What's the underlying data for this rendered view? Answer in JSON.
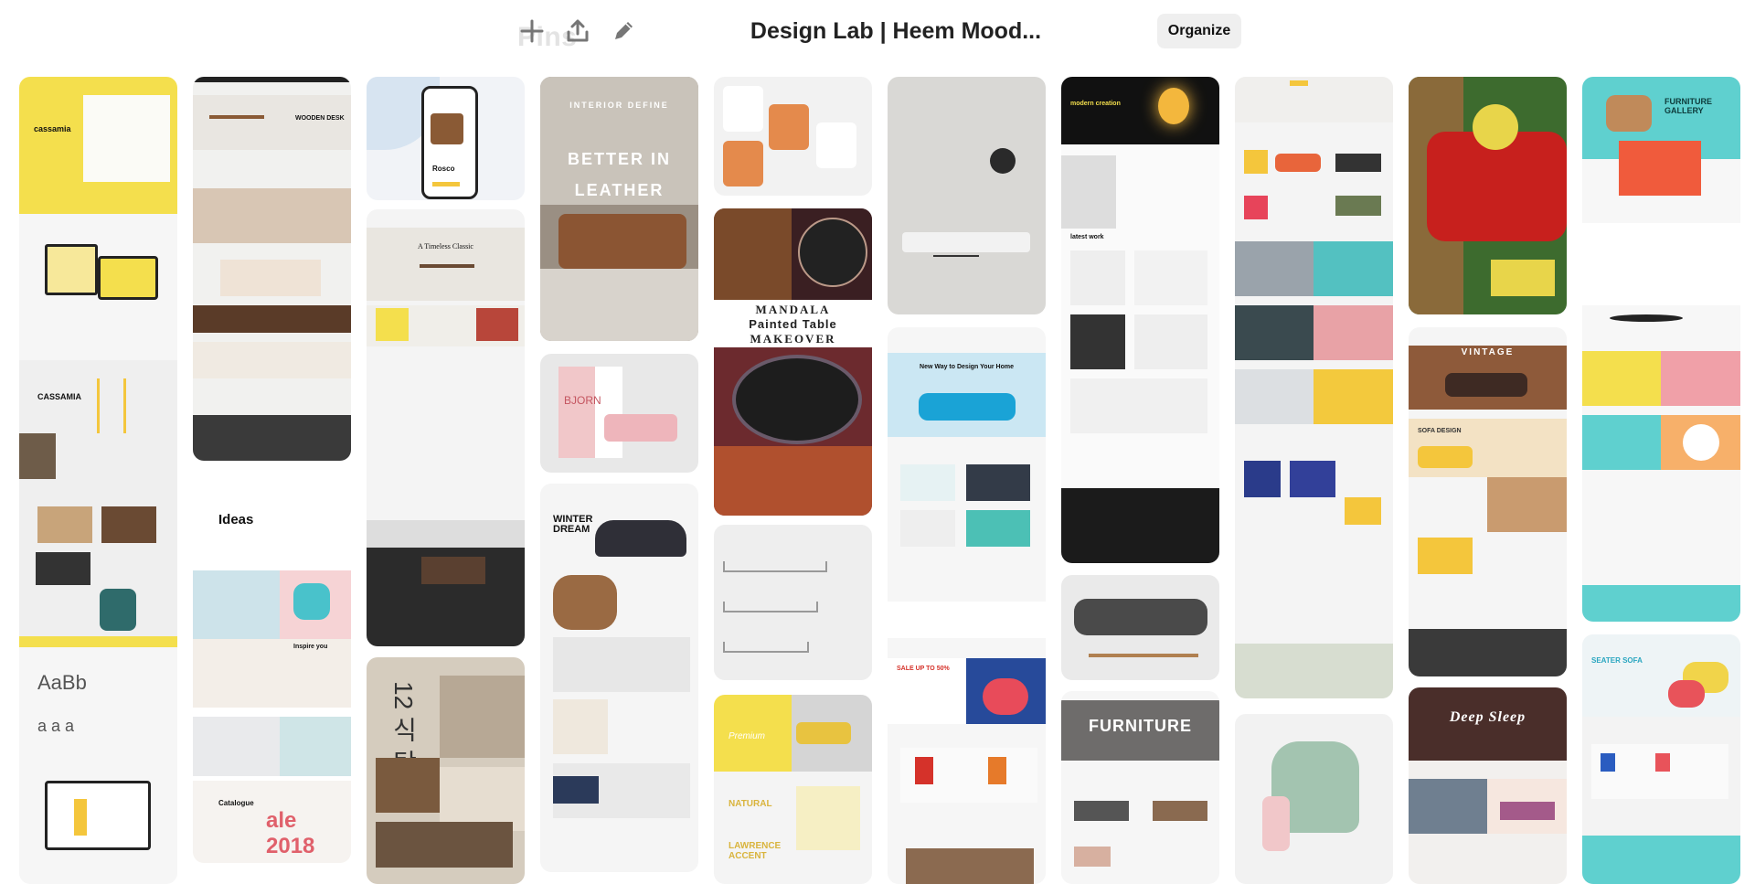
{
  "header": {
    "ghost_label": "Pins",
    "board_title": "Design Lab | Heem Mood...",
    "organize_label": "Organize",
    "icons": [
      "plus-icon",
      "share-icon",
      "pencil-icon"
    ]
  },
  "colors": {
    "yellow": "#f4df4d",
    "teal": "#5fd0cf",
    "dark": "#2b2b2b",
    "red": "#c7201d",
    "pink": "#f1c7c9"
  },
  "pin_text": {
    "cassamia": "cassamia",
    "cassamia_brand": "CASSAMIA",
    "wooden_desk": "WOODEN DESK",
    "rosco": "Rosco",
    "timeless": "A Timeless Classic",
    "better_in": "BETTER IN",
    "leather": "LEATHER",
    "interior_define": "INTERIOR DEFINE",
    "bjorn": "BJORN",
    "winter_dream": "WINTER DREAM",
    "mandala": "MANDALA",
    "painted_table": "Painted Table",
    "makeover": "MAKEOVER",
    "design_home": "New Way to Design Your Home",
    "sale": "SALE UP TO 50%",
    "modern_creation": "modern creation",
    "latest_work": "latest work",
    "furniture": "FURNITURE",
    "vintage": "VINTAGE",
    "sofa_design": "SOFA DESIGN",
    "deep_sleep": "Deep Sleep",
    "furniture_gallery": "FURNITURE GALLERY",
    "seater_sofa": "SEATER SOFA",
    "ideas": "Ideas",
    "inspire": "Inspire you",
    "catalogue": "Catalogue",
    "sale_2018": "ale 2018",
    "aabb": "AaBb",
    "aaa": "a a a",
    "korean": "12 식 탁",
    "natural": "NATURAL",
    "lawrence": "LAWRENCE ACCENT",
    "premium": "Premium"
  }
}
